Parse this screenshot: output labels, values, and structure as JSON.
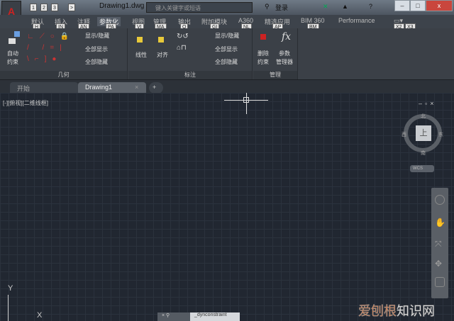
{
  "title": {
    "app_letter": "A",
    "qa_buttons": [
      "1",
      "2",
      "3",
      ">"
    ],
    "document": "Drawing1.dwg",
    "search_placeholder": "键入关键字或短语",
    "signin": "登录",
    "help": "?"
  },
  "tabs": [
    {
      "label": "默认",
      "key": "H"
    },
    {
      "label": "插入",
      "key": "IN"
    },
    {
      "label": "注释",
      "key": "AN"
    },
    {
      "label": "参数化",
      "key": "PA"
    },
    {
      "label": "视图",
      "key": "VI"
    },
    {
      "label": "管理",
      "key": "MA"
    },
    {
      "label": "输出",
      "key": "O"
    },
    {
      "label": "附加模块",
      "key": "GI"
    },
    {
      "label": "A360",
      "key": "NL"
    },
    {
      "label": "精选应用",
      "key": "AP"
    },
    {
      "label": "BIM 360",
      "key": "BM"
    },
    {
      "label": "Performance",
      "key": ""
    }
  ],
  "extra_keys": [
    "X2",
    "X3"
  ],
  "ribbon": {
    "geometry": {
      "title": "几何",
      "auto_constrain": "自动\n约束",
      "show_hide": "显示/隐藏",
      "show_all": "全部显示",
      "hide_all": "全部隐藏"
    },
    "dimension": {
      "title": "标注",
      "linear": "线性",
      "aligned": "对齐",
      "show_hide": "显示/隐藏",
      "show_all": "全部显示",
      "hide_all": "全部隐藏"
    },
    "manage": {
      "title": "管理",
      "delete": "删除\n约束",
      "params": "参数\n管理器"
    }
  },
  "doc_tabs": [
    "开始",
    "Drawing1"
  ],
  "viewport": {
    "label": "[-][俯视][二维线框]",
    "compass": {
      "n": "北",
      "s": "南",
      "e": "东",
      "w": "西",
      "top": "上"
    },
    "wcs": "WCS",
    "y_axis": "Y",
    "x_axis": "X",
    "command": "_dynconstraint"
  },
  "watermark": {
    "a": "爱刨根",
    "b": "知识网"
  }
}
